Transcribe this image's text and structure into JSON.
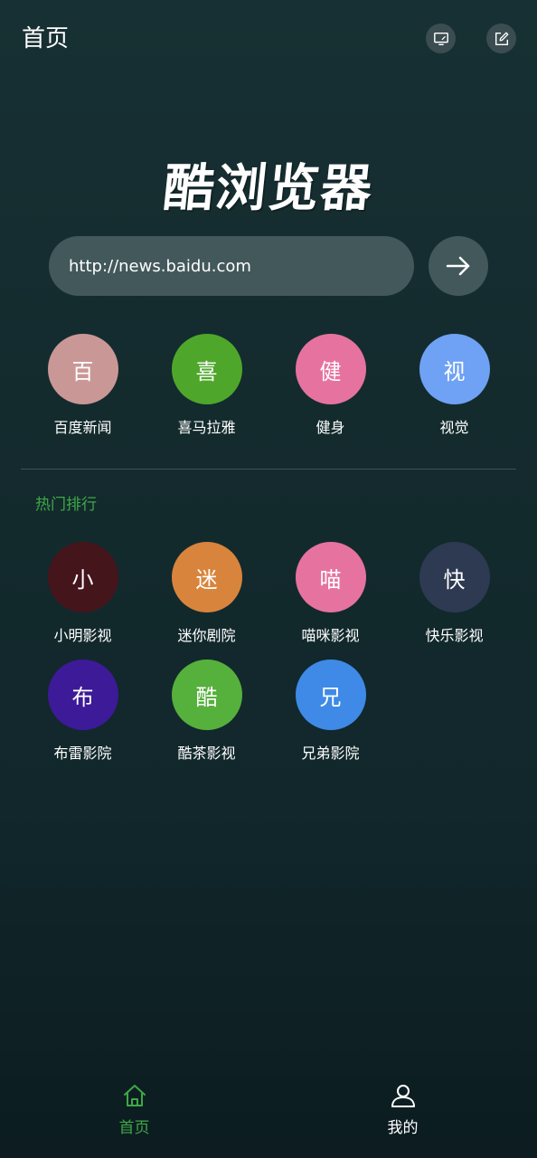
{
  "header": {
    "title": "首页",
    "screen_icon": "monitor-icon",
    "edit_icon": "edit-icon"
  },
  "brand": {
    "logo_text": "酷浏览器"
  },
  "search": {
    "value": "http://news.baidu.com",
    "go_icon": "arrow-right-icon"
  },
  "shortcuts": [
    {
      "initial": "百",
      "label": "百度新闻",
      "color": "#c99896"
    },
    {
      "initial": "喜",
      "label": "喜马拉雅",
      "color": "#4ea72a"
    },
    {
      "initial": "健",
      "label": "健身",
      "color": "#e6739f"
    },
    {
      "initial": "视",
      "label": "视觉",
      "color": "#6fa2f4"
    }
  ],
  "hot": {
    "title": "热门排行",
    "items": [
      {
        "initial": "小",
        "label": "小明影视",
        "color": "#45151c"
      },
      {
        "initial": "迷",
        "label": "迷你剧院",
        "color": "#d9843c"
      },
      {
        "initial": "喵",
        "label": "喵咪影视",
        "color": "#e6739f"
      },
      {
        "initial": "快",
        "label": "快乐影视",
        "color": "#2d3a52"
      },
      {
        "initial": "布",
        "label": "布雷影院",
        "color": "#3c1a98"
      },
      {
        "initial": "酷",
        "label": "酷茶影视",
        "color": "#56b03c"
      },
      {
        "initial": "兄",
        "label": "兄弟影院",
        "color": "#3f8ae6"
      }
    ]
  },
  "nav": {
    "home_label": "首页",
    "mine_label": "我的",
    "active_color": "#3ea845"
  }
}
